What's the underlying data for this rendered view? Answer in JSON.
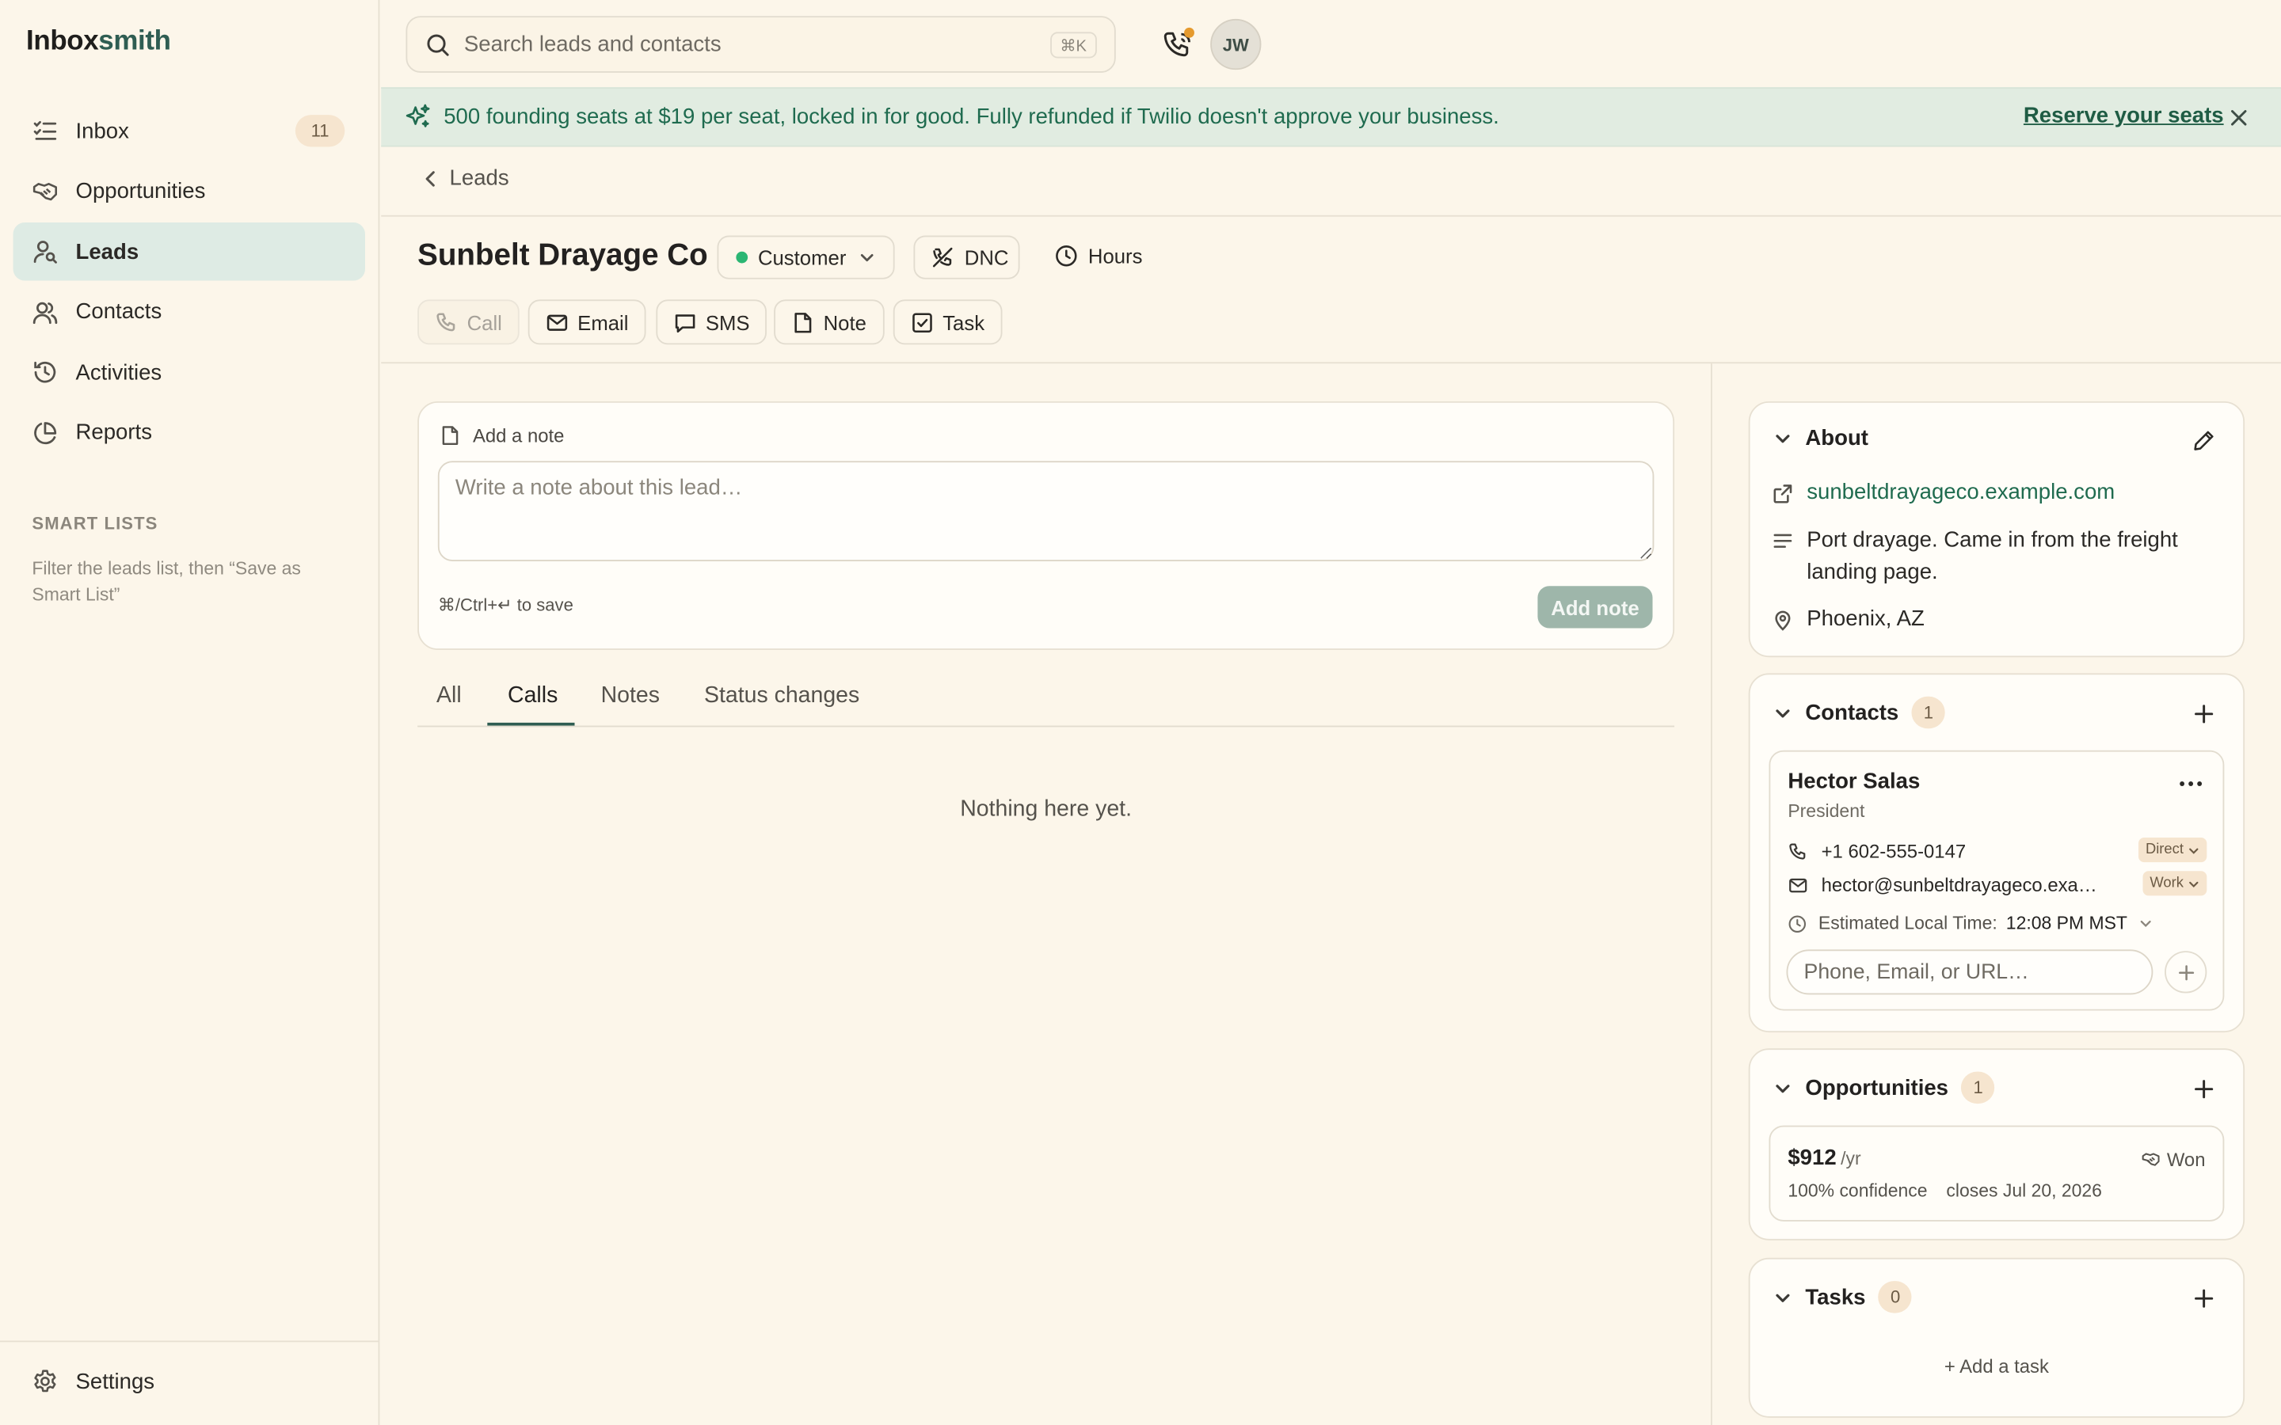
{
  "app": {
    "brand_part1": "Inbox",
    "brand_part2": "smith"
  },
  "sidebar": {
    "items": [
      {
        "label": "Inbox",
        "icon": "inbox-list-icon",
        "badge": "11"
      },
      {
        "label": "Opportunities",
        "icon": "handshake-icon"
      },
      {
        "label": "Leads",
        "icon": "user-search-icon",
        "active": true
      },
      {
        "label": "Contacts",
        "icon": "users-icon"
      },
      {
        "label": "Activities",
        "icon": "history-icon"
      },
      {
        "label": "Reports",
        "icon": "pie-chart-icon"
      }
    ],
    "smart_lists_title": "SMART LISTS",
    "smart_lists_hint": "Filter the leads list, then “Save as Smart List”",
    "settings_label": "Settings"
  },
  "topbar": {
    "search_placeholder": "Search leads and contacts",
    "search_shortcut": "⌘K",
    "avatar_initials": "JW"
  },
  "banner": {
    "message": "500 founding seats at $19 per seat, locked in for good. Fully refunded if Twilio doesn't approve your business.",
    "cta": "Reserve your seats"
  },
  "lead": {
    "breadcrumb": "Leads",
    "name": "Sunbelt Drayage Co",
    "status": "Customer",
    "dnc_label": "DNC",
    "hours_label": "Hours",
    "actions": {
      "call": "Call",
      "email": "Email",
      "sms": "SMS",
      "note": "Note",
      "task": "Task"
    }
  },
  "note_composer": {
    "title": "Add a note",
    "placeholder": "Write a note about this lead…",
    "hint": "⌘/Ctrl+↵ to save",
    "submit": "Add note"
  },
  "activity_tabs": {
    "tabs": [
      "All",
      "Calls",
      "Notes",
      "Status changes"
    ],
    "active": "Calls",
    "empty_text": "Nothing here yet."
  },
  "about": {
    "title": "About",
    "website": "sunbeltdrayageco.example.com",
    "description": "Port drayage. Came in from the freight landing page.",
    "location": "Phoenix, AZ"
  },
  "contacts": {
    "title": "Contacts",
    "count": "1",
    "items": [
      {
        "name": "Hector Salas",
        "role": "President",
        "phone": "+1 602-555-0147",
        "phone_type": "Direct",
        "email": "hector@sunbeltdrayageco.exa…",
        "email_type": "Work",
        "local_time_label": "Estimated Local Time:",
        "local_time": "12:08 PM MST"
      }
    ],
    "add_placeholder": "Phone, Email, or URL…"
  },
  "opportunities": {
    "title": "Opportunities",
    "count": "1",
    "items": [
      {
        "amount": "$912",
        "period": "/yr",
        "status": "Won",
        "confidence": "100% confidence",
        "closes": "closes Jul 20, 2026"
      }
    ]
  },
  "tasks": {
    "title": "Tasks",
    "count": "0",
    "add_label": "+ Add a task"
  },
  "colors": {
    "accent": "#2f5d52",
    "status_customer": "#2bb673",
    "banner_bg": "#e1ece1",
    "page_bg": "#fcf6ea"
  }
}
